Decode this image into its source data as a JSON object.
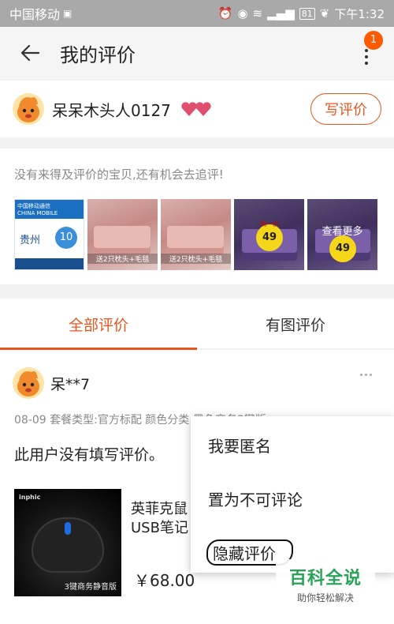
{
  "status_bar": {
    "carrier": "中国移动",
    "battery": "81",
    "time": "下午1:32"
  },
  "header": {
    "title": "我的评价",
    "badge_count": "1"
  },
  "user": {
    "name": "呆呆木头人0127",
    "write_button": "写评价"
  },
  "pending": {
    "hint": "没有来得及评价的宝贝,还有机会去追评!",
    "thumbs": [
      {
        "kind": "mobile-card",
        "brand_cn": "中国移动通信",
        "brand_en": "CHINA MOBILE",
        "province": "贵州",
        "value": "10"
      },
      {
        "kind": "bedding-pink",
        "caption": "送2只枕头+毛毯"
      },
      {
        "kind": "bedding-pink",
        "caption": "送2只枕头+毛毯"
      },
      {
        "kind": "bedding-purple",
        "tag_top": "统一价",
        "tag": "49"
      },
      {
        "kind": "bedding-purple",
        "overlay": "查看更多",
        "tag": "49"
      }
    ]
  },
  "tabs": [
    {
      "label": "全部评价",
      "active": true
    },
    {
      "label": "有图评价",
      "active": false
    }
  ],
  "review": {
    "user": "呆**7",
    "meta": "08-09  套餐类型:官方标配  颜色分类:黑色商务3键版",
    "text": "此用户没有填写评价。",
    "product_brand": "inphic",
    "product_caption": "3键商务静音版",
    "product_name_line1": "英菲克鼠",
    "product_name_line2": "USB笔记",
    "price": "￥68.00"
  },
  "menu": {
    "items": [
      "我要匿名",
      "置为不可评论",
      "隐藏评价"
    ]
  },
  "watermark": {
    "title": "百科全说",
    "subtitle": "助你轻松解决"
  },
  "colors": {
    "accent": "#e8541e",
    "badge": "#ff5a00",
    "status_bar": "#a9a9a9"
  }
}
